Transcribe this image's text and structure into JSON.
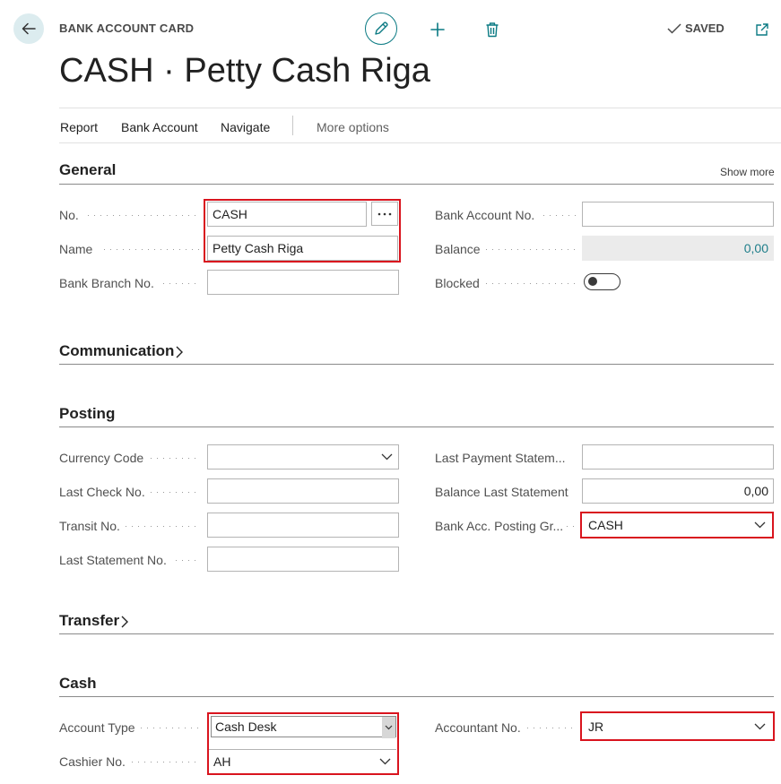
{
  "header": {
    "kicker": "BANK ACCOUNT CARD",
    "title": "CASH · Petty Cash Riga",
    "saved_label": "SAVED"
  },
  "icons": {
    "back": "arrow-left-icon",
    "edit": "pencil-icon",
    "add": "plus-icon",
    "delete": "trash-icon",
    "saved": "checkmark-icon",
    "popout": "open-in-new-window-icon"
  },
  "actions": {
    "report": "Report",
    "bank_account": "Bank Account",
    "navigate": "Navigate",
    "more_options": "More options"
  },
  "general": {
    "title": "General",
    "show_more": "Show more",
    "no_label": "No.",
    "no_value": "CASH",
    "name_label": "Name",
    "name_value": "Petty Cash Riga",
    "bank_branch_label": "Bank Branch No.",
    "bank_branch_value": "",
    "bank_account_no_label": "Bank Account No.",
    "bank_account_no_value": "",
    "balance_label": "Balance",
    "balance_value": "0,00",
    "blocked_label": "Blocked",
    "blocked_value": false
  },
  "communication": {
    "title": "Communication"
  },
  "posting": {
    "title": "Posting",
    "currency_code_label": "Currency Code",
    "currency_code_value": "",
    "last_check_label": "Last Check No.",
    "last_check_value": "",
    "transit_label": "Transit No.",
    "transit_value": "",
    "last_statement_label": "Last Statement No.",
    "last_statement_value": "",
    "last_payment_statement_label": "Last Payment Statem...",
    "last_payment_statement_value": "",
    "balance_last_statement_label": "Balance Last Statement",
    "balance_last_statement_value": "0,00",
    "posting_group_label": "Bank Acc. Posting Gr...",
    "posting_group_value": "CASH"
  },
  "transfer": {
    "title": "Transfer"
  },
  "cash": {
    "title": "Cash",
    "account_type_label": "Account Type",
    "account_type_value": "Cash Desk",
    "cashier_label": "Cashier No.",
    "cashier_value": "AH",
    "accountant_label": "Accountant No.",
    "accountant_value": "JR"
  },
  "colors": {
    "accent": "#0a7a83",
    "highlight": "#d9141e",
    "balance_value": "#1e7e8a"
  }
}
